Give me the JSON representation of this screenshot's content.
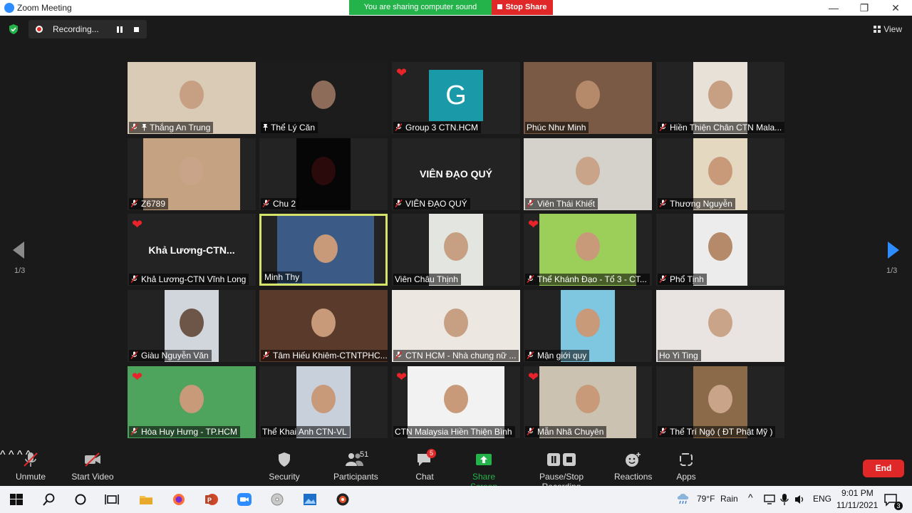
{
  "window": {
    "title": "Zoom Meeting",
    "minimize": "—",
    "maximize": "❐",
    "close": "✕"
  },
  "share_banner": {
    "message": "You are sharing computer sound",
    "stop_label": "Stop Share"
  },
  "recording": {
    "label": "Recording..."
  },
  "view": {
    "label": "View"
  },
  "pagination": {
    "left": "1/3",
    "right": "1/3"
  },
  "participants": [
    {
      "name": "Thắng An Trung",
      "muted": true,
      "pinned": true,
      "heart": false
    },
    {
      "name": "Thể Lý Căn",
      "muted": false,
      "pinned": true,
      "heart": false
    },
    {
      "name": "Group 3 CTN.HCM",
      "muted": true,
      "pinned": false,
      "heart": true,
      "avatar_letter": "G"
    },
    {
      "name": "Phúc Như Minh",
      "muted": false,
      "pinned": false,
      "heart": false
    },
    {
      "name": "Hiền Thiện Chân CTN Mala...",
      "muted": true,
      "pinned": false,
      "heart": false
    },
    {
      "name": "Z6789",
      "muted": true,
      "pinned": false,
      "heart": false
    },
    {
      "name": "Chu 2",
      "muted": true,
      "pinned": false,
      "heart": false
    },
    {
      "name": "VIÊN ĐẠO QUÝ",
      "muted": true,
      "pinned": false,
      "heart": false,
      "center_text": "VIÊN ĐẠO QUÝ"
    },
    {
      "name": "Viên Thái Khiết",
      "muted": true,
      "pinned": false,
      "heart": false
    },
    {
      "name": "Thương Nguyễn",
      "muted": true,
      "pinned": false,
      "heart": false
    },
    {
      "name": "Khả Lương-CTN Vĩnh Long",
      "muted": true,
      "pinned": false,
      "heart": true,
      "center_text": "Khả  Lương-CTN..."
    },
    {
      "name": "Minh Thy",
      "muted": false,
      "pinned": false,
      "heart": false,
      "active": true
    },
    {
      "name": "Viên Châu Thịnh",
      "muted": false,
      "pinned": false,
      "heart": false
    },
    {
      "name": "Thể Khánh Đạo - Tổ 3 - CT...",
      "muted": true,
      "pinned": false,
      "heart": true
    },
    {
      "name": "Phổ Tịnh",
      "muted": true,
      "pinned": false,
      "heart": false
    },
    {
      "name": "Giàu Nguyễn Văn",
      "muted": true,
      "pinned": false,
      "heart": false
    },
    {
      "name": "Tâm Hiếu Khiêm-CTNTPHC...",
      "muted": true,
      "pinned": false,
      "heart": false
    },
    {
      "name": "CTN HCM - Nhà chung nữ ...",
      "muted": true,
      "pinned": false,
      "heart": false
    },
    {
      "name": "Mận giới quy",
      "muted": true,
      "pinned": false,
      "heart": false
    },
    {
      "name": "Ho Yi Ting",
      "muted": false,
      "pinned": false,
      "heart": false
    },
    {
      "name": "Hòa Huy Hưng - TP.HCM",
      "muted": true,
      "pinned": false,
      "heart": true
    },
    {
      "name": "Thể Khai Anh CTN-VL",
      "muted": false,
      "pinned": false,
      "heart": false
    },
    {
      "name": "CTN Malaysia Hiền Thiện Bình",
      "muted": false,
      "pinned": false,
      "heart": true
    },
    {
      "name": "Mẫn Nhã Chuyên",
      "muted": true,
      "pinned": false,
      "heart": true
    },
    {
      "name": "Thể Trí Ngộ ( ĐT Phật Mỹ )",
      "muted": true,
      "pinned": false,
      "heart": false
    }
  ],
  "toolbar": {
    "unmute": "Unmute",
    "start_video": "Start Video",
    "security": "Security",
    "participants": "Participants",
    "participants_count": "51",
    "chat": "Chat",
    "chat_badge": "5",
    "share_screen": "Share Screen",
    "pause_recording": "Pause/Stop Recording",
    "reactions": "Reactions",
    "apps": "Apps",
    "end": "End"
  },
  "taskbar": {
    "temperature": "79°F",
    "weather": "Rain",
    "language": "ENG",
    "time": "9:01 PM",
    "date": "11/11/2021",
    "notification_count": "3"
  },
  "colors": {
    "accent": "#2d8cff",
    "end_red": "#e02828",
    "share_green": "#24b24b",
    "active_border": "#d6e36a",
    "heart": "#e8232a"
  }
}
